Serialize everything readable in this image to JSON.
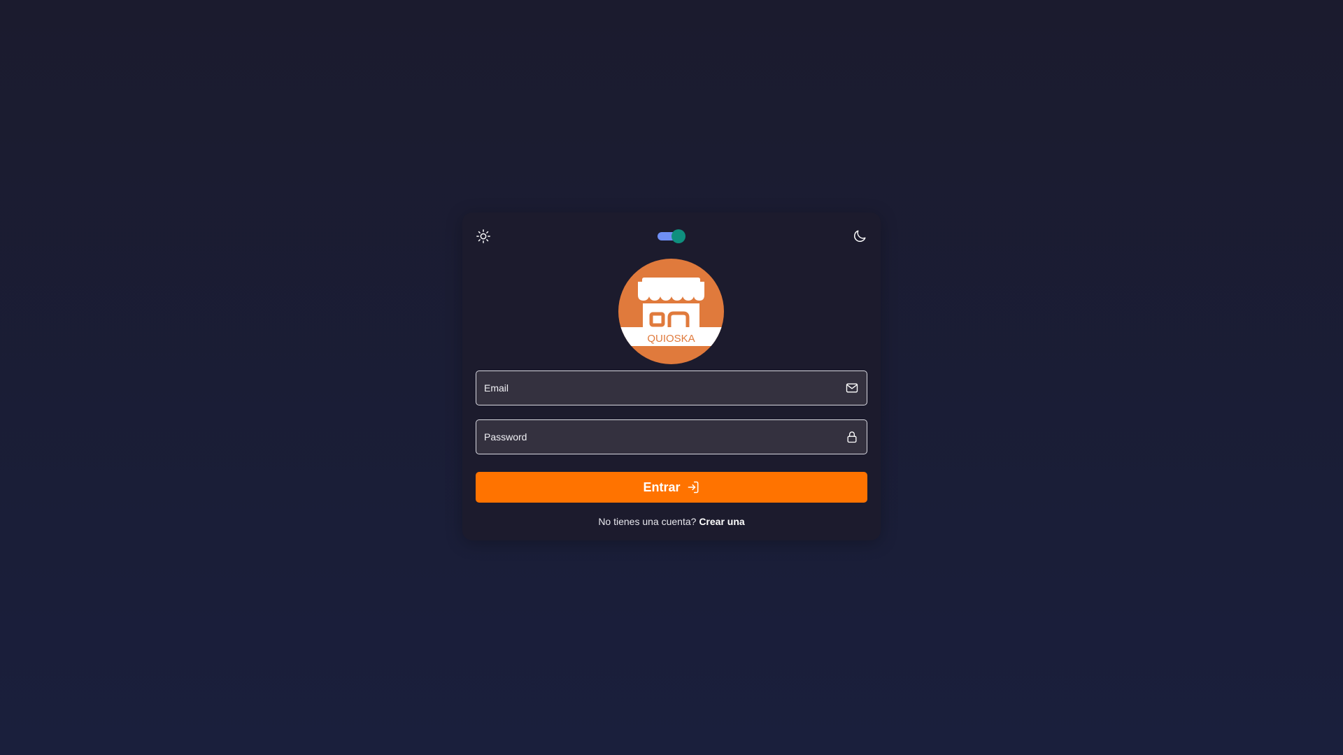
{
  "theme": {
    "light_icon": "sun-icon",
    "dark_icon": "moon-icon",
    "toggle_on": true,
    "toggle_track_color": "#6f8ff5",
    "toggle_knob_color": "#0f8f7e"
  },
  "logo": {
    "text": "QUIOSKA",
    "icon": "storefront-icon",
    "color": "#e07a3c"
  },
  "login": {
    "email": {
      "placeholder": "Email",
      "value": "",
      "icon": "envelope-icon"
    },
    "password": {
      "placeholder": "Password",
      "value": "",
      "icon": "lock-icon"
    },
    "submit_label": "Entrar",
    "submit_icon": "sign-in-icon",
    "accent_color": "#ff7300"
  },
  "signup": {
    "prompt": "No tienes una cuenta?",
    "link_label": "Crear una"
  }
}
